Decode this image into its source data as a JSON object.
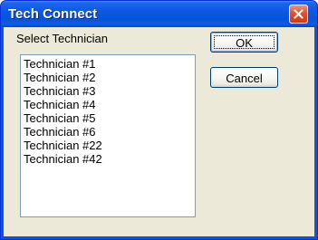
{
  "window": {
    "title": "Tech Connect"
  },
  "dialog": {
    "prompt": "Select Technician",
    "ok_label": "OK",
    "cancel_label": "Cancel",
    "technicians": [
      "Technician #1",
      "Technician #2",
      "Technician #3",
      "Technician #4",
      "Technician #5",
      "Technician #6",
      "Technician #22",
      "Technician #42"
    ]
  },
  "icons": {
    "close": "close-icon"
  },
  "colors": {
    "titlebar": "#0a58e4",
    "close_button": "#e0512c",
    "dialog_background": "#ece9d8",
    "list_border": "#7f9db9",
    "button_border": "#003c74"
  }
}
